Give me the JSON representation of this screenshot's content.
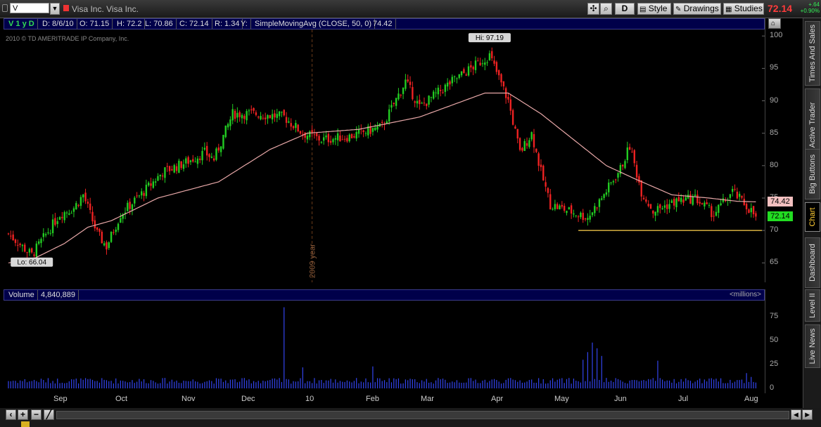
{
  "toolbar": {
    "symbol": "V",
    "company_name": "Visa Inc. Visa Inc.",
    "period_button": "D",
    "style_label": "Style",
    "drawings_label": "Drawings",
    "studies_label": "Studies",
    "last_price": "72.14",
    "net_change": "+.64",
    "pct_change": "+0.90%"
  },
  "price_header": {
    "symbol_period": "V 1 y D",
    "date": "D: 8/6/10",
    "open": "O: 71.15",
    "high": "H: 72.2",
    "low": "L: 70.86",
    "close": "C: 72.14",
    "range": "R: 1.34",
    "y": "Y:",
    "study_name": "SimpleMovingAvg (CLOSE, 50, 0)",
    "study_value": "74.42"
  },
  "copyright": "2010 © TD AMERITRADE IP Company, Inc.",
  "volume_header": {
    "label": "Volume",
    "value": "4,840,889",
    "unit": "<millions>"
  },
  "colors": {
    "up": "#22cc22",
    "down": "#ee2222",
    "sma": "#e8a8a8",
    "volume": "#3344ee",
    "support": "#ffd34d"
  },
  "chart_data": {
    "type": "candlestick",
    "price_ticks": [
      100,
      95,
      90,
      85,
      80,
      75,
      70,
      65
    ],
    "ylim": [
      62,
      101
    ],
    "volume_ticks": [
      75,
      50,
      25,
      0
    ],
    "volume_ylim": [
      0,
      92
    ],
    "months": [
      "Sep",
      "Oct",
      "Nov",
      "Dec",
      "10",
      "Feb",
      "Mar",
      "Apr",
      "May",
      "Jun",
      "Jul",
      "Aug"
    ],
    "year_marker": "2009 year",
    "annotations": {
      "high": "Hi: 97.19",
      "low": "Lo: 66.04"
    },
    "sma_label": "74.42",
    "last_label": "72.14",
    "support_level": 70,
    "close_anchors": [
      [
        0,
        69.5
      ],
      [
        6,
        67.5
      ],
      [
        10,
        66.2
      ],
      [
        22,
        72.5
      ],
      [
        28,
        73.5
      ],
      [
        32,
        75.5
      ],
      [
        38,
        69.5
      ],
      [
        42,
        67.5
      ],
      [
        48,
        72.5
      ],
      [
        58,
        76
      ],
      [
        66,
        79
      ],
      [
        76,
        80.5
      ],
      [
        84,
        82
      ],
      [
        88,
        81
      ],
      [
        96,
        88
      ],
      [
        106,
        88
      ],
      [
        118,
        87.5
      ],
      [
        126,
        85
      ],
      [
        134,
        84
      ],
      [
        146,
        84.5
      ],
      [
        160,
        86
      ],
      [
        170,
        93
      ],
      [
        176,
        89
      ],
      [
        190,
        93
      ],
      [
        200,
        95.5
      ],
      [
        206,
        97
      ],
      [
        214,
        90
      ],
      [
        219,
        82
      ],
      [
        224,
        85
      ],
      [
        228,
        79
      ],
      [
        232,
        74
      ],
      [
        240,
        73
      ],
      [
        248,
        72
      ],
      [
        254,
        75
      ],
      [
        262,
        79.5
      ],
      [
        266,
        83
      ],
      [
        271,
        76
      ],
      [
        276,
        73
      ],
      [
        286,
        74.5
      ],
      [
        294,
        75
      ],
      [
        302,
        72.5
      ],
      [
        310,
        76
      ],
      [
        318,
        73
      ],
      [
        320,
        72.14
      ]
    ],
    "sma_anchors": [
      [
        0,
        65
      ],
      [
        10,
        65.5
      ],
      [
        24,
        68
      ],
      [
        34,
        70.5
      ],
      [
        44,
        71.5
      ],
      [
        64,
        75
      ],
      [
        90,
        77.5
      ],
      [
        112,
        82.5
      ],
      [
        128,
        85
      ],
      [
        150,
        85.6
      ],
      [
        176,
        87.5
      ],
      [
        204,
        91.2
      ],
      [
        214,
        91.2
      ],
      [
        228,
        88
      ],
      [
        242,
        84
      ],
      [
        256,
        80
      ],
      [
        268,
        78
      ],
      [
        284,
        75.5
      ],
      [
        300,
        75
      ],
      [
        312,
        74.5
      ],
      [
        320,
        74.42
      ]
    ],
    "volume_spikes": [
      [
        118,
        85
      ],
      [
        126,
        22
      ],
      [
        156,
        23
      ],
      [
        246,
        30
      ],
      [
        248,
        38
      ],
      [
        250,
        48
      ],
      [
        252,
        42
      ],
      [
        254,
        34
      ],
      [
        278,
        29
      ],
      [
        316,
        16
      ],
      [
        318,
        12
      ]
    ]
  },
  "side_tabs": [
    "Times And Sales",
    "Active Trader",
    "Big Buttons",
    "Chart",
    "Dashboard",
    "Level II",
    "Live News"
  ],
  "active_tab": "Chart"
}
